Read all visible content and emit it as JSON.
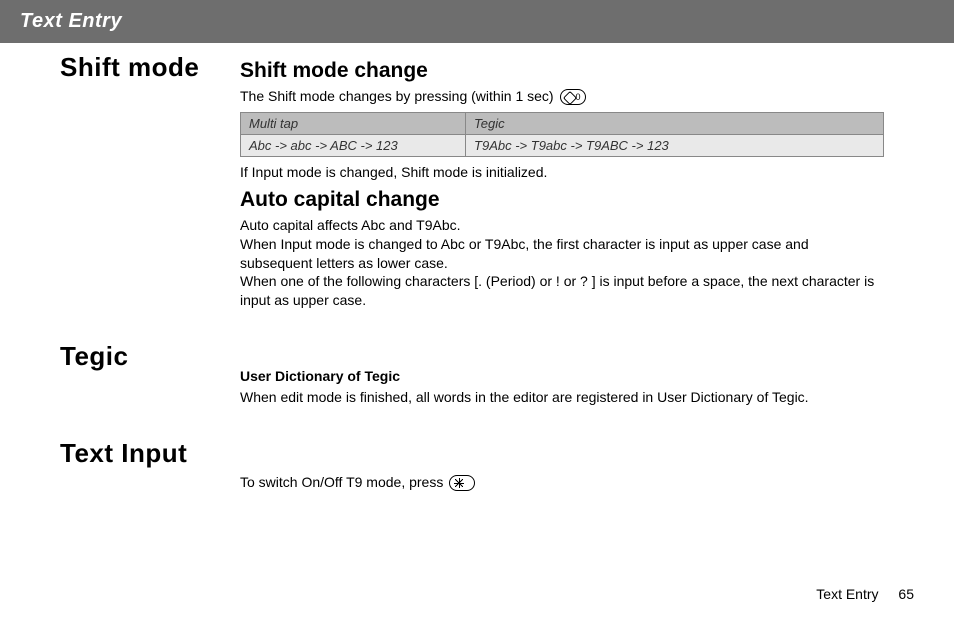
{
  "banner": "Text Entry",
  "sections": {
    "shift_mode": {
      "side": "Shift mode",
      "h_shift": "Shift mode change",
      "shift_body1": "The Shift mode changes by pressing (within 1 sec)",
      "table": {
        "h1": "Multi tap",
        "h2": "Tegic",
        "r1": "Abc -> abc -> ABC -> 123",
        "r2": "T9Abc -> T9abc -> T9ABC -> 123"
      },
      "shift_body2": "If Input mode is changed, Shift mode is initialized.",
      "h_auto": "Auto capital change",
      "auto_body": "Auto capital affects Abc and T9Abc.\nWhen Input mode is changed to Abc or T9Abc, the first character is input as upper case and subsequent letters as lower case.\nWhen one of the following characters [. (Period) or ! or ? ] is input before a space, the next character is input as upper case."
    },
    "tegic": {
      "side": "Tegic",
      "h3": "User Dictionary of Tegic",
      "body": "When edit mode is finished, all words in the editor are registered in User Dictionary of Tegic."
    },
    "text_input": {
      "side": "Text Input",
      "body": "To switch On/Off T9 mode, press"
    }
  },
  "footer": {
    "section": "Text Entry",
    "page": "65"
  }
}
